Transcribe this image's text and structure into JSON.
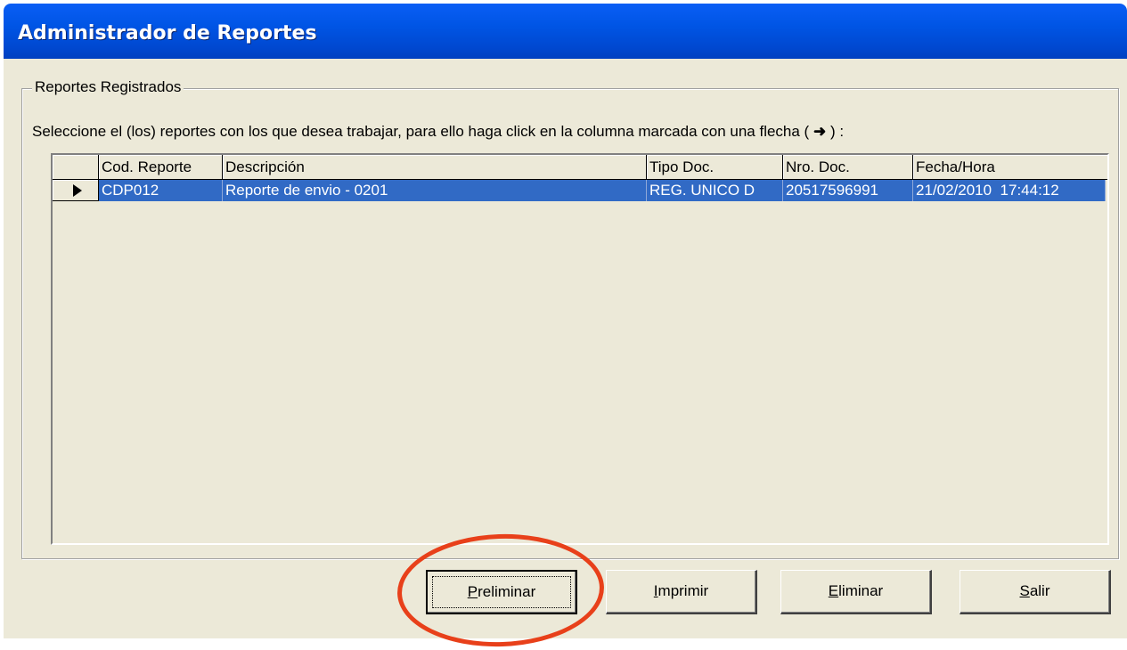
{
  "window": {
    "title": "Administrador de Reportes"
  },
  "group": {
    "legend": "Reportes Registrados"
  },
  "instruction": "Seleccione el (los) reportes con los que desea trabajar, para ello haga click en la columna marcada con una flecha (",
  "instruction_end": ") :",
  "grid": {
    "columns": [
      "",
      "Cod. Reporte",
      "Descripción",
      "Tipo Doc.",
      "Nro. Doc.",
      "Fecha/Hora"
    ],
    "rows": [
      {
        "code": "CDP012",
        "description": "Reporte de envio - 0201",
        "doc_type": "REG. UNICO D",
        "doc_number": "20517596991",
        "datetime": "21/02/2010  17:44:12"
      }
    ],
    "selected_color": "#316ac5"
  },
  "buttons": {
    "preliminar": {
      "pre": "",
      "key": "P",
      "post": "reliminar"
    },
    "imprimir": {
      "pre": "",
      "key": "I",
      "post": "mprimir"
    },
    "eliminar": {
      "pre": "",
      "key": "E",
      "post": "liminar"
    },
    "salir": {
      "pre": "",
      "key": "S",
      "post": "alir"
    }
  },
  "annotation": {
    "color": "#e8401a"
  }
}
